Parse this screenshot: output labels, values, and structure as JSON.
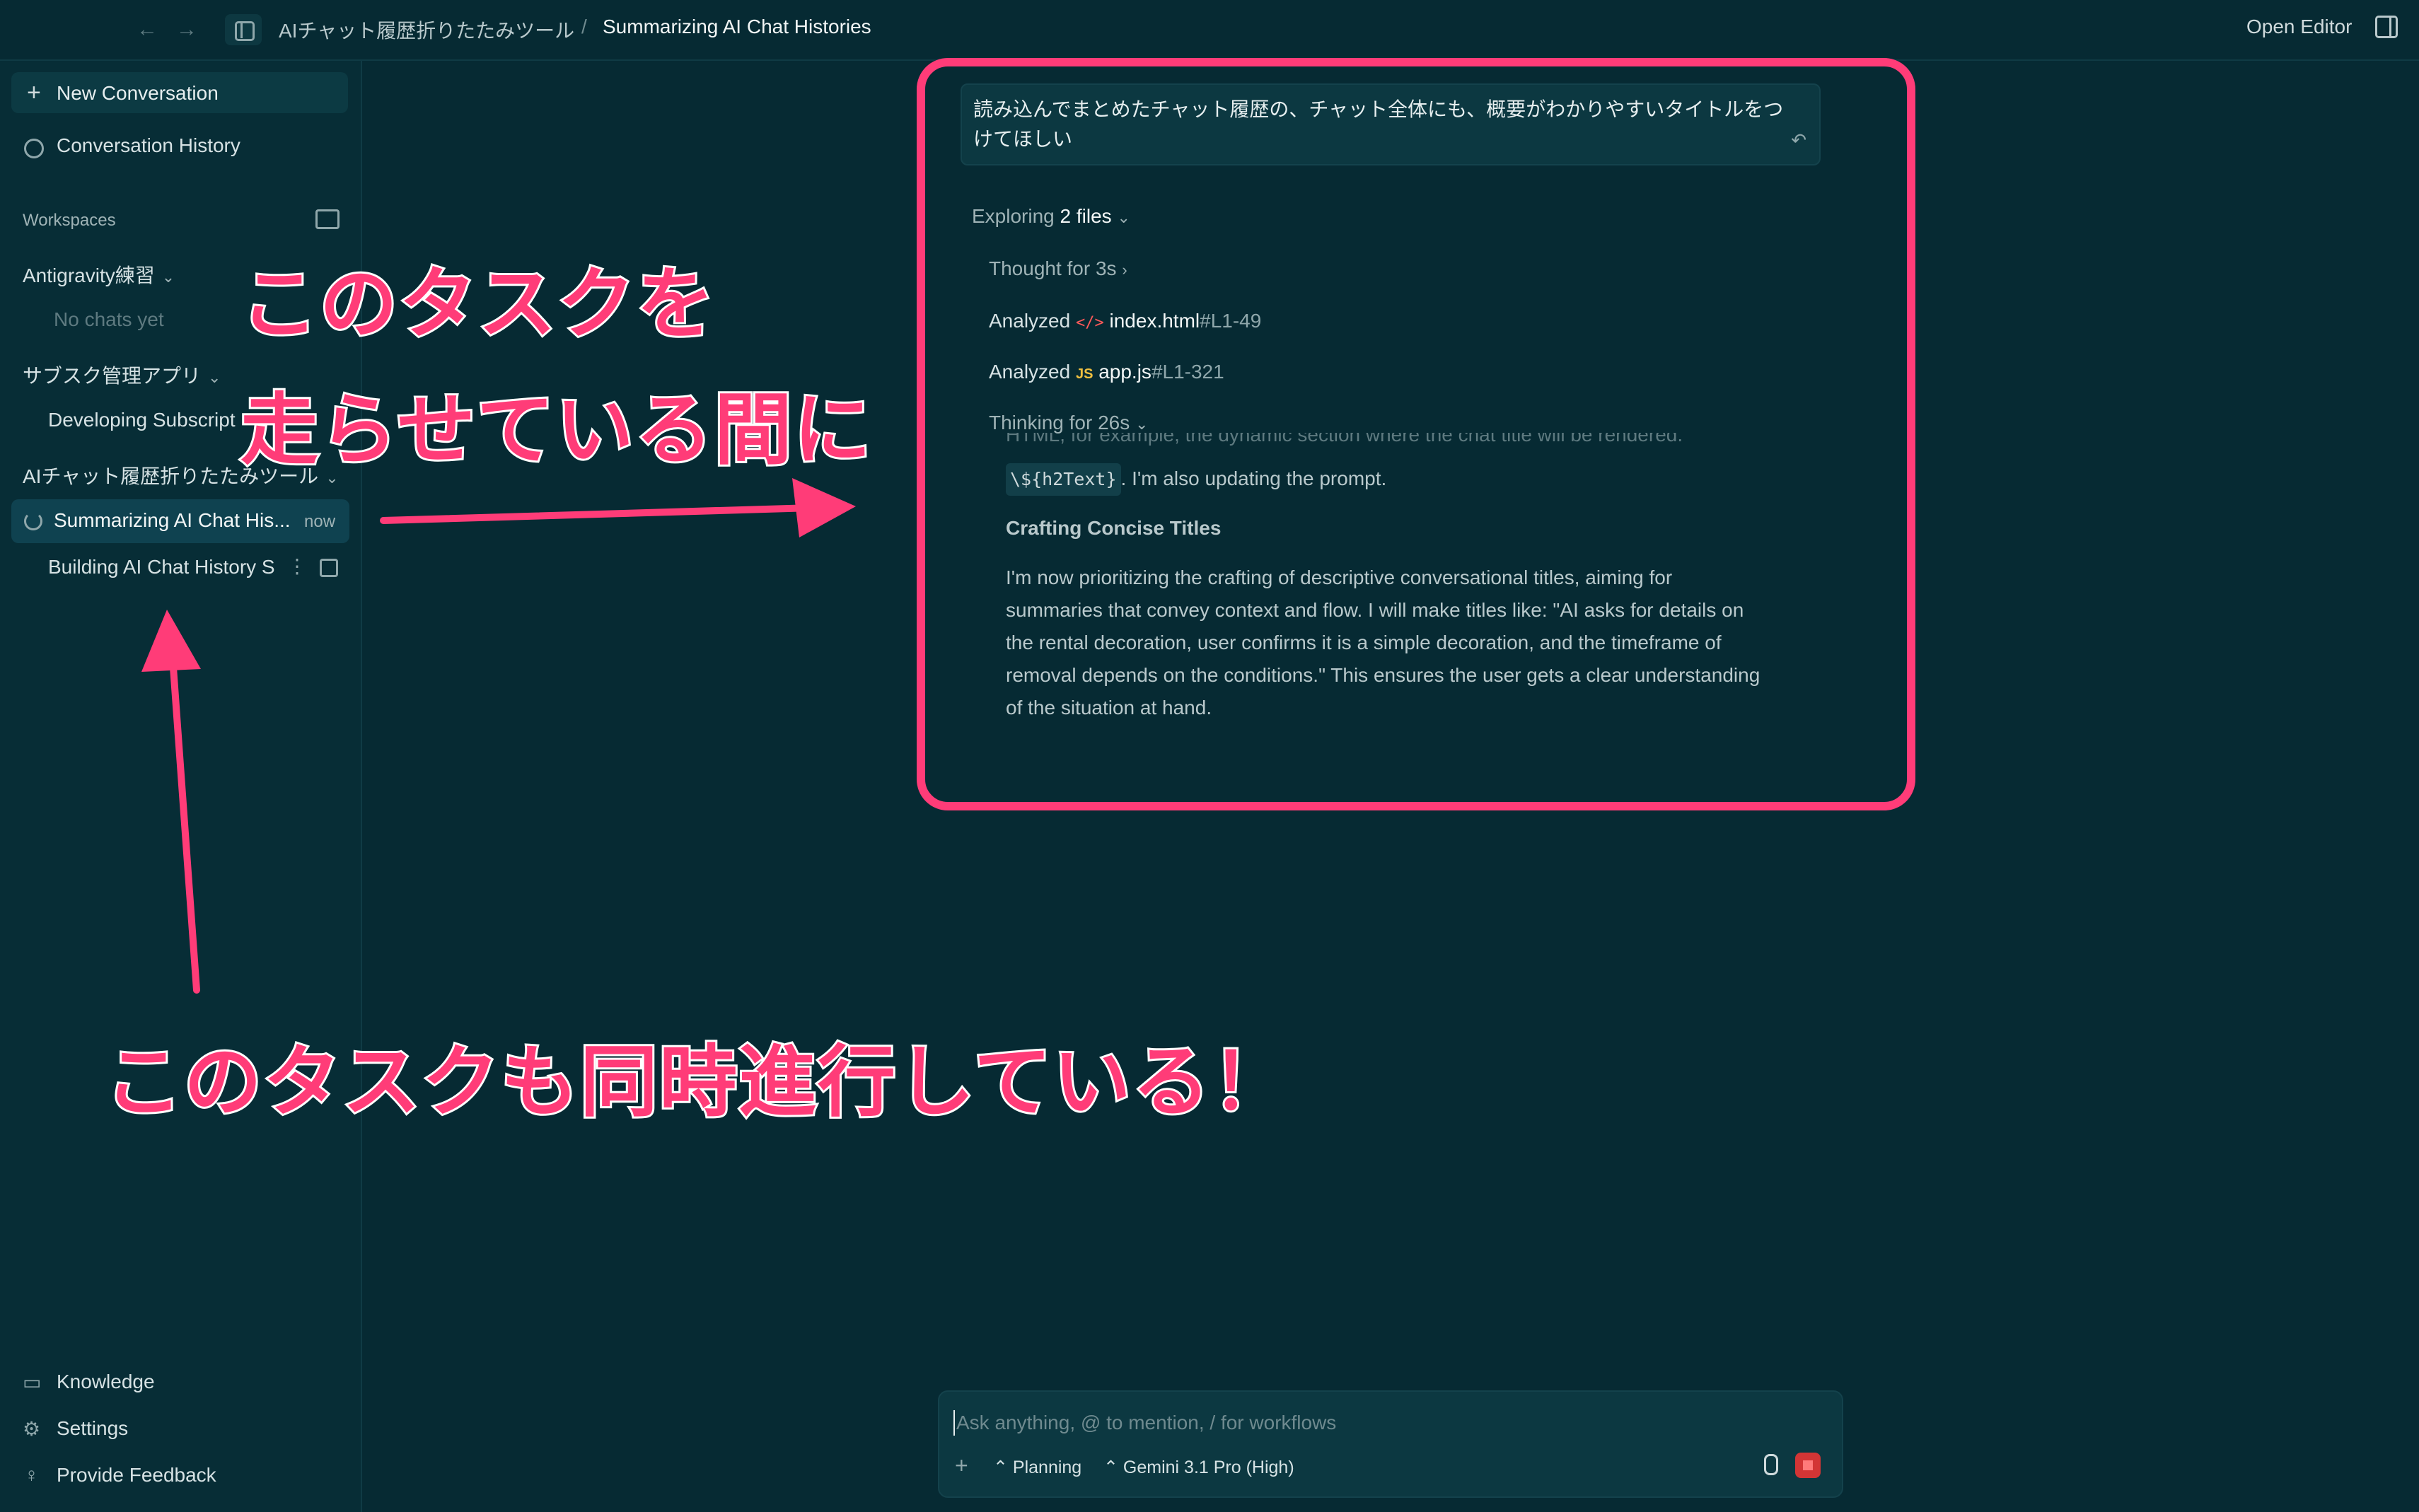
{
  "topbar": {
    "breadcrumb_workspace": "AIチャット履歴折りたたみツール",
    "breadcrumb_separator": "/",
    "breadcrumb_conversation": "Summarizing AI Chat Histories",
    "open_editor": "Open Editor"
  },
  "sidebar": {
    "new_conversation": "New Conversation",
    "conversation_history": "Conversation History",
    "workspaces_label": "Workspaces",
    "workspaces": [
      {
        "name": "Antigravity練習",
        "chats": [
          {
            "title": "No chats yet"
          }
        ]
      },
      {
        "name": "サブスク管理アプリ",
        "chats": [
          {
            "title": "Developing Subscript"
          }
        ]
      },
      {
        "name": "AIチャット履歴折りたたみツール",
        "chats": [
          {
            "title": "Summarizing AI Chat His...",
            "time": "now"
          },
          {
            "title": "Building AI Chat History S"
          }
        ]
      }
    ],
    "bottom": {
      "knowledge": "Knowledge",
      "settings": "Settings",
      "feedback": "Provide Feedback"
    }
  },
  "conversation": {
    "user_prompt": "読み込んでまとめたチャット履歴の、チャット全体にも、概要がわかりやすいタイトルをつけてほしい",
    "exploring": "Exploring",
    "exploring_count": "2 files",
    "thought": "Thought for 3s",
    "analyzed_1": {
      "verb": "Analyzed",
      "file": "index.html",
      "range": "#L1-49"
    },
    "analyzed_2": {
      "verb": "Analyzed",
      "file": "app.js",
      "range": "#L1-321",
      "badge": "JS"
    },
    "thinking": "Thinking for 26s",
    "thinking_faded": "HTML, for example, the dynamic section where the chat title will be rendered.",
    "code_chip": "\\${h2Text}",
    "after_chip": ". I'm also updating the prompt.",
    "heading": "Crafting Concise Titles",
    "paragraph_lines": [
      "I'm now prioritizing the crafting of descriptive conversational titles, aiming for",
      "summaries that convey context and flow. I will make titles like: \"AI asks for details on",
      "the rental decoration, user confirms it is a simple decoration, and the timeframe of",
      "removal depends on the conditions.\" This ensures the user gets a clear understanding",
      "of the situation at hand."
    ]
  },
  "composer": {
    "placeholder": "Ask anything, @ to mention, / for workflows",
    "mode": "Planning",
    "model": "Gemini 3.1 Pro (High)"
  },
  "annotations": {
    "line1": "このタスクを",
    "line2": "走らせている間に",
    "line3": "このタスクも同時進行している！"
  },
  "colors": {
    "accent": "#ff3c78",
    "background": "#062a33",
    "stop": "#d33535"
  }
}
